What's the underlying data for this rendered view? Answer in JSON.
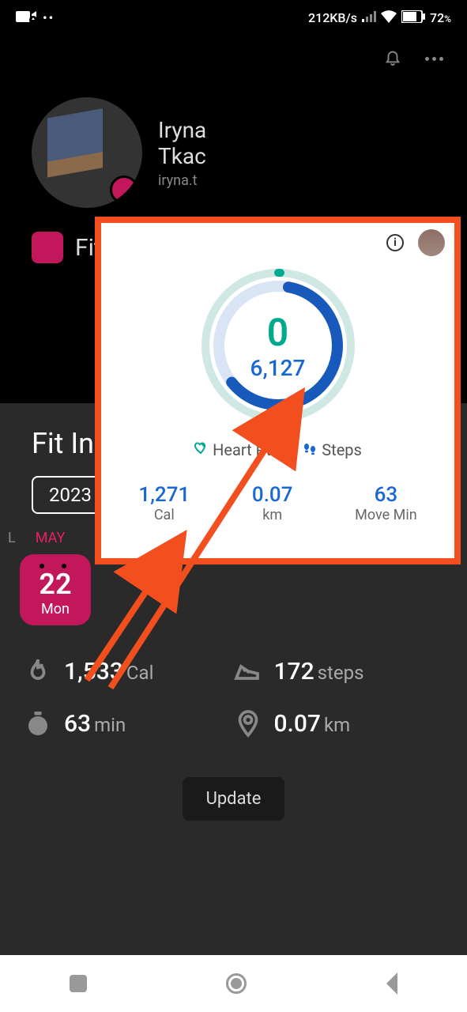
{
  "status_bar": {
    "data_rate": "212KB/s",
    "battery": "72",
    "battery_pct": "%"
  },
  "profile": {
    "name_line1": "Iryna",
    "name_line2": "Tkac",
    "email": "iryna.t"
  },
  "app": {
    "name": "Fit"
  },
  "panel": {
    "title": "Fit In",
    "year": "2023",
    "month_l": "L",
    "month_may": "MAY",
    "date_num": "22",
    "date_day": "Mon"
  },
  "stats": {
    "cal_val": "1,533",
    "cal_unit": "Cal",
    "steps_val": "172",
    "steps_unit": "steps",
    "min_val": "63",
    "min_unit": "min",
    "km_val": "0.07",
    "km_unit": "km"
  },
  "update_btn": "Update",
  "fit": {
    "heart_pts": "0",
    "steps": "6,127",
    "legend_heart": "Heart Pts",
    "legend_steps": "Steps",
    "cal_val": "1,271",
    "cal_lbl": "Cal",
    "km_val": "0.07",
    "km_lbl": "km",
    "move_val": "63",
    "move_lbl": "Move Min"
  }
}
